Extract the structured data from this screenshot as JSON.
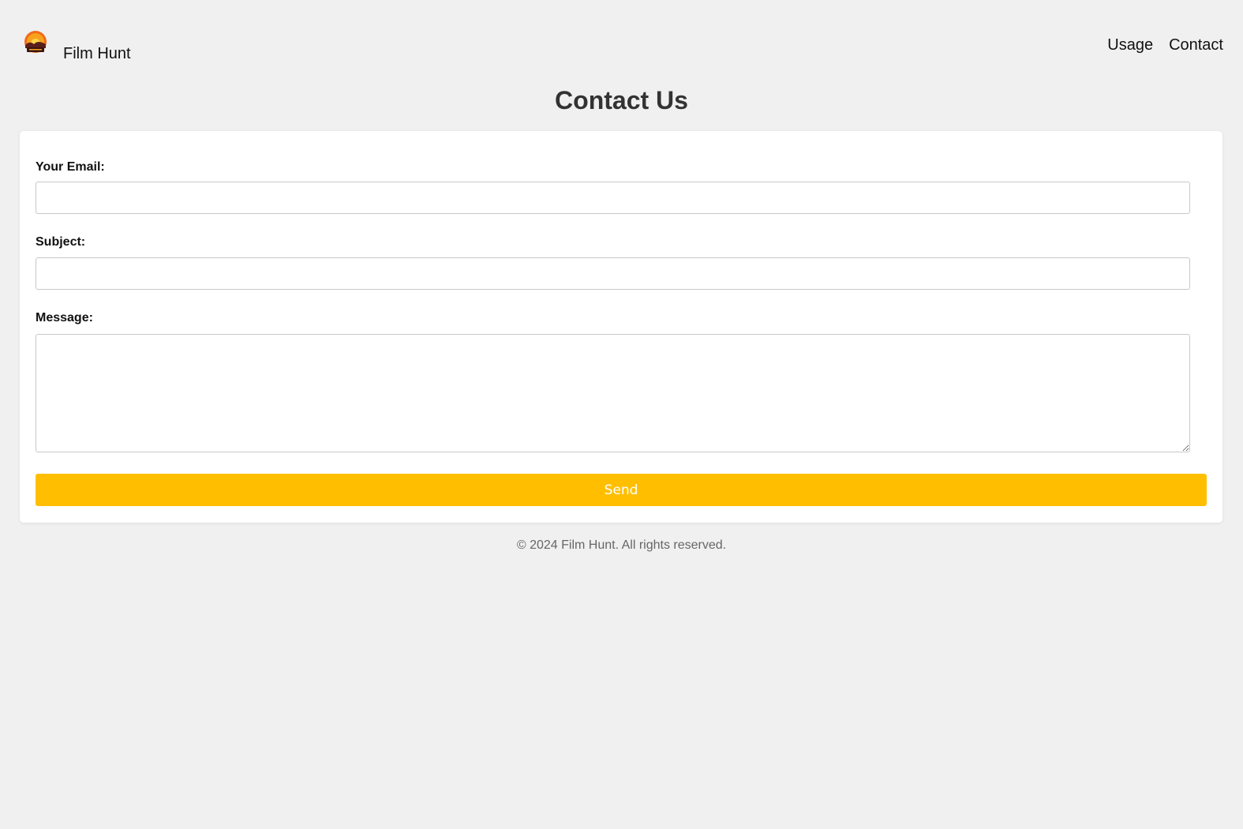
{
  "header": {
    "brand_name": "Film Hunt",
    "logo_icon": "film-hunt-logo-icon",
    "nav": [
      {
        "label": "Usage"
      },
      {
        "label": "Contact"
      }
    ]
  },
  "page": {
    "title": "Contact Us"
  },
  "form": {
    "email_label": "Your Email:",
    "email_value": "",
    "subject_label": "Subject:",
    "subject_value": "",
    "message_label": "Message:",
    "message_value": "",
    "send_label": "Send"
  },
  "footer": {
    "text": "© 2024 Film Hunt. All rights reserved."
  },
  "colors": {
    "background": "#f0f0f0",
    "button": "#ffbf00",
    "button_text": "#ffffff",
    "title": "#333333"
  }
}
